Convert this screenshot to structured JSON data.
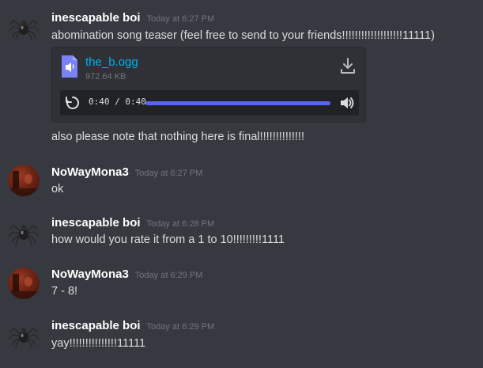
{
  "messages": [
    {
      "username": "inescapable boi",
      "timestamp": "Today at 6:27 PM",
      "text": "abomination song teaser (feel free to send to your friends!!!!!!!!!!!!!!!!!!!11111)",
      "attachment": {
        "file_name": "the_b.ogg",
        "file_size": "972.64 KB",
        "time_display": "0:40 / 0:40",
        "progress": 1.0
      },
      "followup": "also please note that nothing here is final!!!!!!!!!!!!!!"
    },
    {
      "username": "NoWayMona3",
      "timestamp": "Today at 6:27 PM",
      "text": "ok"
    },
    {
      "username": "inescapable boi",
      "timestamp": "Today at 6:28 PM",
      "text": "how would you rate it from a 1 to 10!!!!!!!!!1111"
    },
    {
      "username": "NoWayMona3",
      "timestamp": "Today at 6:29 PM",
      "text": "7 - 8!"
    },
    {
      "username": "inescapable boi",
      "timestamp": "Today at 6:29 PM",
      "text": "yay!!!!!!!!!!!!!!!11111"
    }
  ],
  "colors": {
    "background": "#36393f",
    "link": "#00b0f4",
    "progress": "#5865f2",
    "username": "#ffffff",
    "timestamp": "#72767d"
  },
  "icons": {
    "spider_avatar": "spider-icon",
    "file": "audio-file-icon",
    "download": "download-icon",
    "replay": "replay-icon",
    "volume": "volume-icon"
  }
}
